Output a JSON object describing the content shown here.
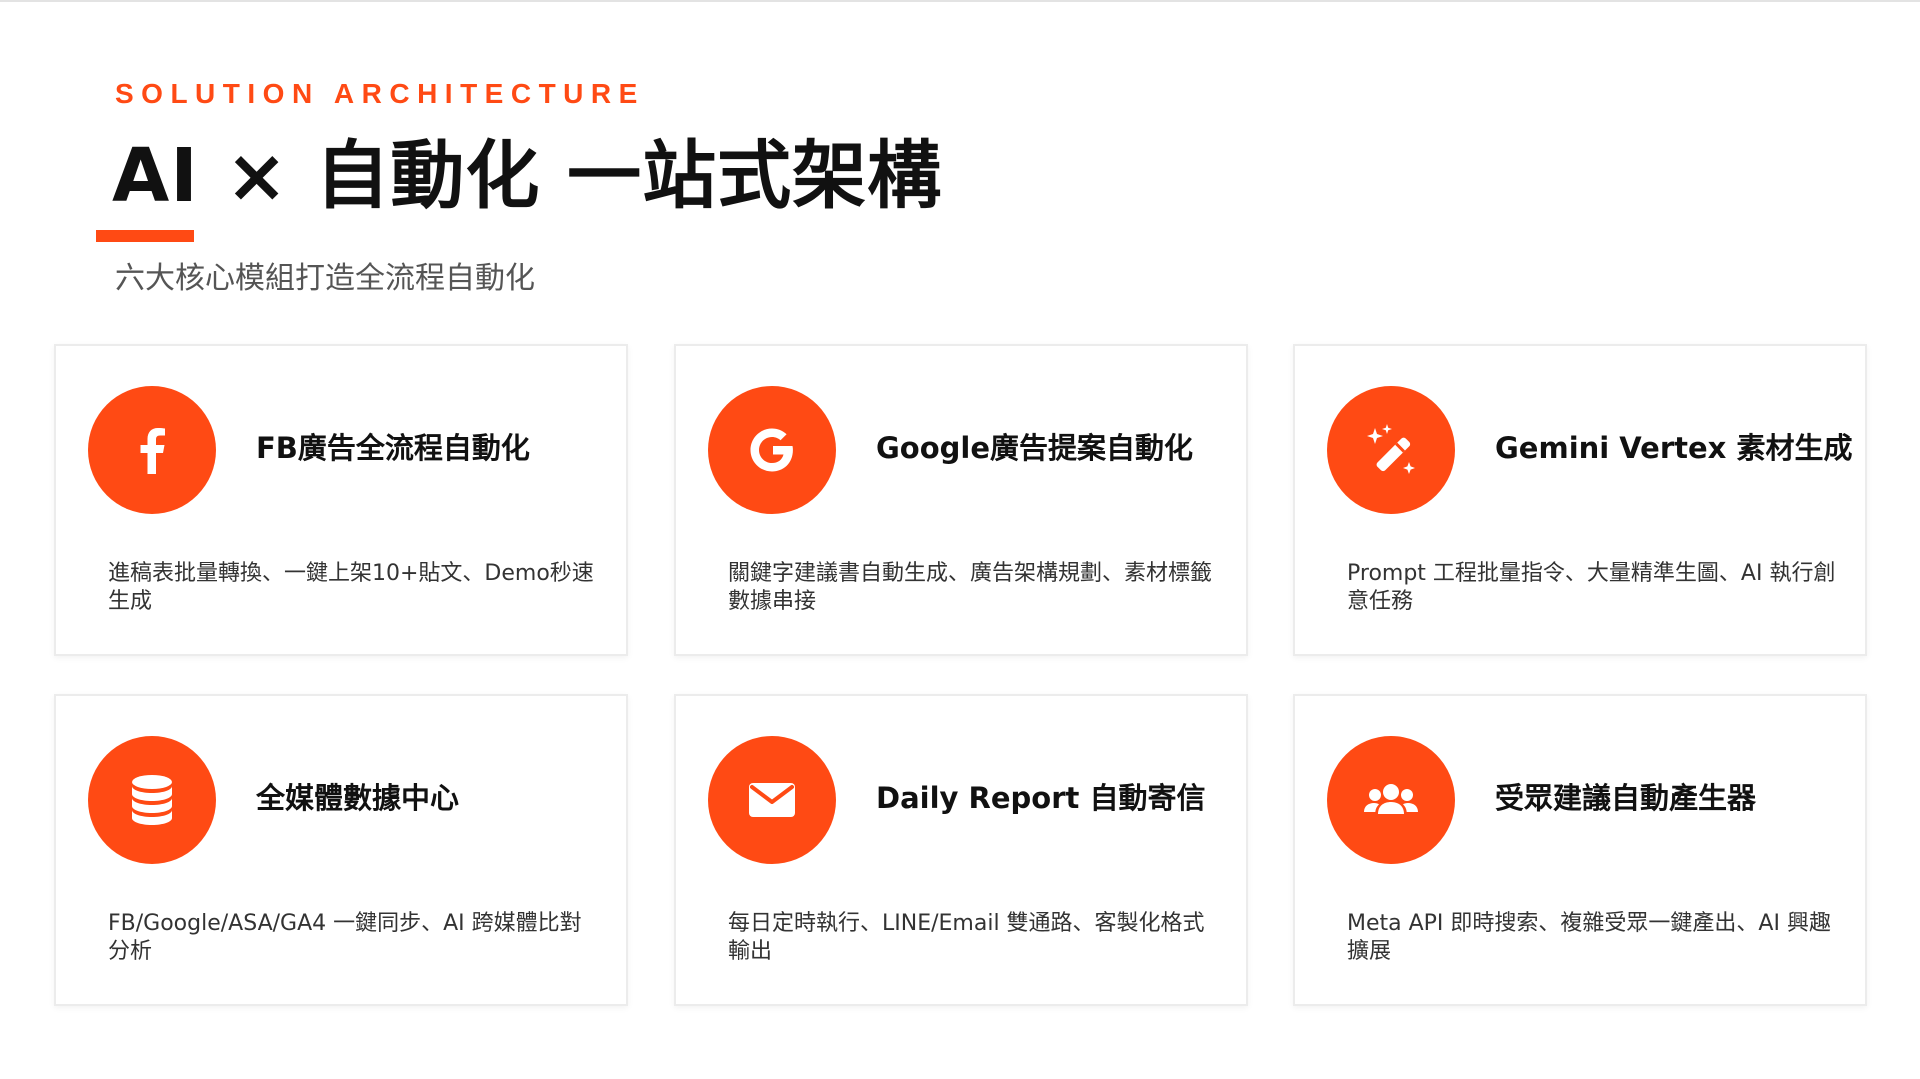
{
  "header": {
    "eyebrow": "SOLUTION ARCHITECTURE",
    "title": "AI × 自動化 一站式架構",
    "subtitle": "六大核心模組打造全流程自動化"
  },
  "colors": {
    "accent": "#ff4a14",
    "title": "#111111",
    "subtitle": "#555555",
    "body": "#333333",
    "card_border": "#ececec"
  },
  "cards": [
    {
      "icon": "facebook-icon",
      "title": "FB廣告全流程自動化",
      "description": "進稿表批量轉換、一鍵上架10+貼文、Demo秒速生成"
    },
    {
      "icon": "google-icon",
      "title": "Google廣告提案自動化",
      "description": "關鍵字建議書自動生成、廣告架構規劃、素材標籤數據串接"
    },
    {
      "icon": "magic-wand-icon",
      "title": "Gemini Vertex 素材生成",
      "description": "Prompt 工程批量指令、大量精準生圖、AI 執行創意任務"
    },
    {
      "icon": "database-icon",
      "title": "全媒體數據中心",
      "description": "FB/Google/ASA/GA4 一鍵同步、AI 跨媒體比對分析"
    },
    {
      "icon": "envelope-icon",
      "title": "Daily Report 自動寄信",
      "description": "每日定時執行、LINE/Email 雙通路、客製化格式輸出"
    },
    {
      "icon": "users-icon",
      "title": "受眾建議自動產生器",
      "description": "Meta API 即時搜索、複雜受眾一鍵產出、AI 興趣擴展"
    }
  ]
}
